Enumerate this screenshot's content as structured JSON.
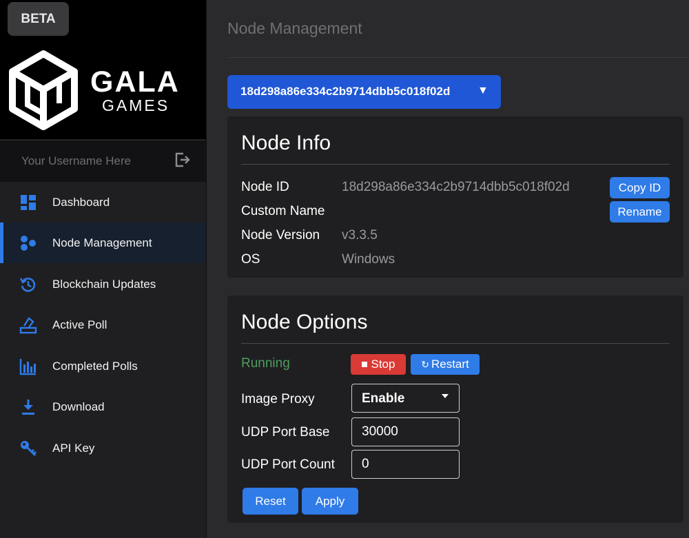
{
  "sidebar": {
    "beta_label": "BETA",
    "brand_line1": "GALA",
    "brand_line2": "GAMES",
    "username": "Your Username Here",
    "items": [
      {
        "label": "Dashboard",
        "icon": "dashboard-icon"
      },
      {
        "label": "Node Management",
        "icon": "node-management-icon",
        "active": true
      },
      {
        "label": "Blockchain Updates",
        "icon": "blockchain-updates-icon"
      },
      {
        "label": "Active Poll",
        "icon": "active-poll-icon"
      },
      {
        "label": "Completed Polls",
        "icon": "completed-polls-icon"
      },
      {
        "label": "Download",
        "icon": "download-icon"
      },
      {
        "label": "API Key",
        "icon": "api-key-icon"
      }
    ]
  },
  "main": {
    "title": "Node Management",
    "node_selector": "18d298a86e334c2b9714dbb5c018f02d",
    "node_info": {
      "title": "Node Info",
      "rows": [
        {
          "label": "Node ID",
          "value": "18d298a86e334c2b9714dbb5c018f02d"
        },
        {
          "label": "Custom Name",
          "value": ""
        },
        {
          "label": "Node Version",
          "value": "v3.3.5"
        },
        {
          "label": "OS",
          "value": "Windows"
        }
      ],
      "copy_id_label": "Copy ID",
      "rename_label": "Rename"
    },
    "node_options": {
      "title": "Node Options",
      "status": "Running",
      "stop_label": "Stop",
      "restart_label": "Restart",
      "image_proxy_label": "Image Proxy",
      "image_proxy_value": "Enable",
      "udp_port_base_label": "UDP Port Base",
      "udp_port_base_value": "30000",
      "udp_port_count_label": "UDP Port Count",
      "udp_port_count_value": "0",
      "reset_label": "Reset",
      "apply_label": "Apply"
    }
  },
  "colors": {
    "accent": "#2f7be8",
    "selector": "#1f57d6",
    "danger": "#d93a36",
    "running": "#4e9d60"
  }
}
